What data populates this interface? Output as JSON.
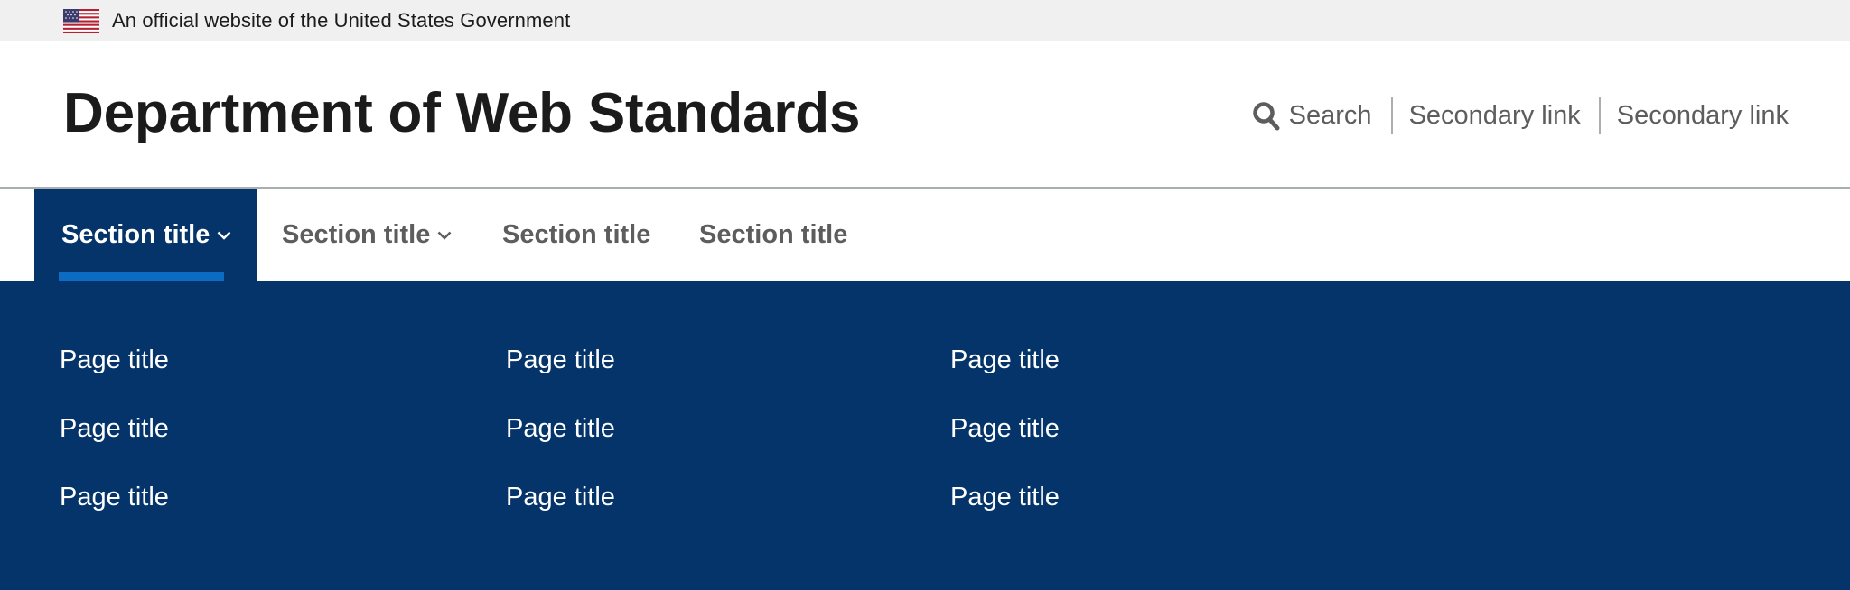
{
  "banner": {
    "text": "An official website of the United States Government",
    "flag_icon": "us-flag-icon"
  },
  "header": {
    "title": "Department of Web Standards",
    "search_label": "Search",
    "secondary_links": [
      "Secondary link",
      "Secondary link"
    ]
  },
  "primary_nav": [
    {
      "label": "Section title",
      "has_dropdown": true,
      "active": true
    },
    {
      "label": "Section title",
      "has_dropdown": true,
      "active": false
    },
    {
      "label": "Section title",
      "has_dropdown": false,
      "active": false
    },
    {
      "label": "Section title",
      "has_dropdown": false,
      "active": false
    }
  ],
  "megamenu": {
    "columns": [
      [
        "Page title",
        "Page title",
        "Page title"
      ],
      [
        "Page title",
        "Page title",
        "Page title"
      ],
      [
        "Page title",
        "Page title",
        "Page title"
      ]
    ]
  },
  "colors": {
    "primary_dark": "#04346a",
    "accent": "#0b6cc2",
    "banner_bg": "#f0f0f0",
    "text": "#1b1b1b",
    "muted": "#5d5d5d"
  }
}
